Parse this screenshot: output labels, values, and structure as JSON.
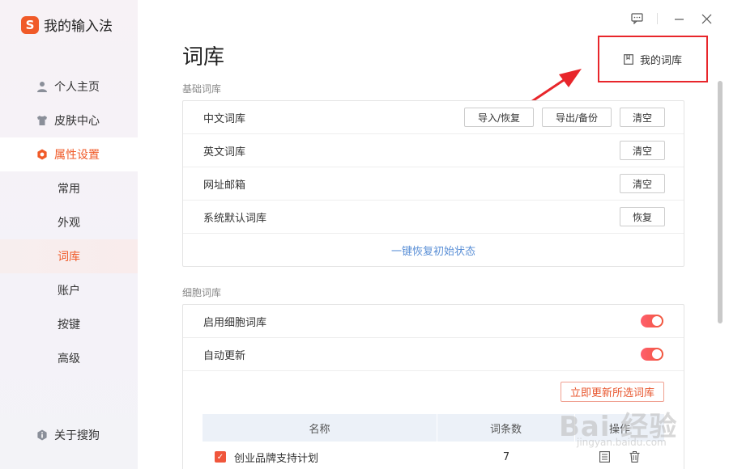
{
  "app": {
    "name": "我的输入法",
    "logo_glyph": "S",
    "brand_color": "#f05a28"
  },
  "sidebar": {
    "items": [
      {
        "label": "个人主页",
        "icon": "person-icon"
      },
      {
        "label": "皮肤中心",
        "icon": "shirt-icon"
      },
      {
        "label": "属性设置",
        "icon": "hexagon-gear-icon",
        "active": true
      }
    ],
    "sub_items": [
      {
        "label": "常用"
      },
      {
        "label": "外观"
      },
      {
        "label": "词库",
        "active": true
      },
      {
        "label": "账户"
      },
      {
        "label": "按键"
      },
      {
        "label": "高级"
      }
    ],
    "about": {
      "label": "关于搜狗",
      "icon": "info-icon"
    }
  },
  "window": {
    "feedback_icon": "chat-icon",
    "minimize_icon": "minimize-icon",
    "close_icon": "close-icon"
  },
  "main": {
    "title": "词库",
    "my_library": {
      "label": "我的词库",
      "icon": "bookmark-icon"
    },
    "basic": {
      "section_label": "基础词库",
      "rows": [
        {
          "name": "中文词库",
          "buttons": [
            "导入/恢复",
            "导出/备份",
            "清空"
          ]
        },
        {
          "name": "英文词库",
          "buttons": [
            "清空"
          ]
        },
        {
          "name": "网址邮箱",
          "buttons": [
            "清空"
          ]
        },
        {
          "name": "系统默认词库",
          "buttons": [
            "恢复"
          ]
        }
      ],
      "restore_link": "一键恢复初始状态"
    },
    "cell": {
      "section_label": "细胞词库",
      "rows": [
        {
          "name": "启用细胞词库",
          "enabled": true
        },
        {
          "name": "自动更新",
          "enabled": true
        }
      ],
      "update_button": "立即更新所选词库",
      "table": {
        "headers": [
          "名称",
          "词条数",
          "操作"
        ],
        "rows": [
          {
            "checked": true,
            "name": "创业品牌支持计划",
            "count": "7"
          }
        ]
      }
    }
  },
  "watermark": {
    "text": "Bai 经验",
    "sub": "jingyan.baidu.com"
  }
}
